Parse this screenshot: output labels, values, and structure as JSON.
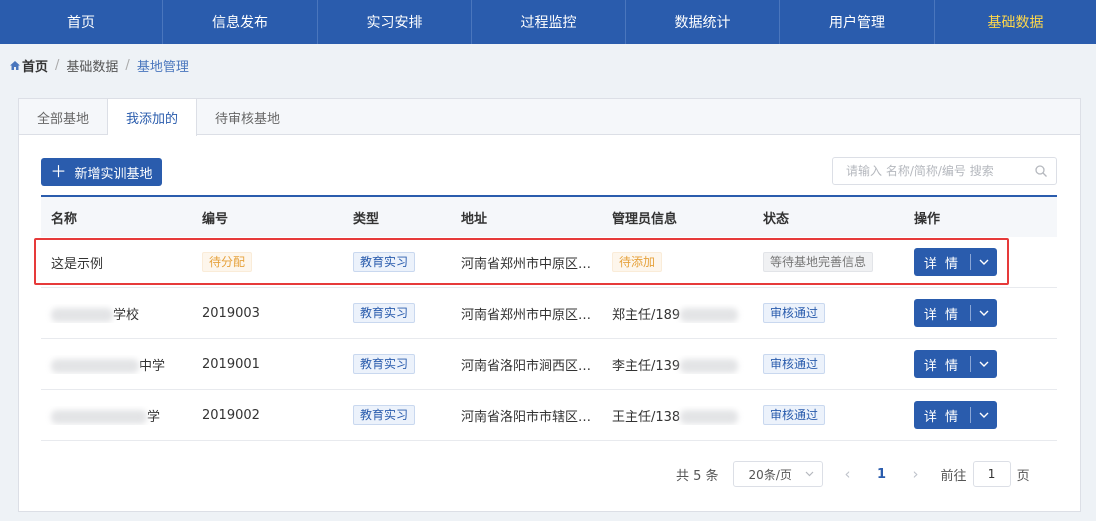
{
  "nav": [
    {
      "label": "首页",
      "name": "nav-home"
    },
    {
      "label": "信息发布",
      "name": "nav-info-publish"
    },
    {
      "label": "实习安排",
      "name": "nav-internship-arrangement"
    },
    {
      "label": "过程监控",
      "name": "nav-process-monitoring"
    },
    {
      "label": "数据统计",
      "name": "nav-data-statistics"
    },
    {
      "label": "用户管理",
      "name": "nav-user-management"
    },
    {
      "label": "基础数据",
      "name": "nav-basic-data",
      "active": true
    }
  ],
  "breadcrumb": {
    "home": "首页",
    "level1": "基础数据",
    "current": "基地管理"
  },
  "tabs": [
    "全部基地",
    "我添加的",
    "待审核基地"
  ],
  "active_tab": 1,
  "toolbar": {
    "add_label": "新增实训基地",
    "search_placeholder": "请输入 名称/简称/编号 搜索"
  },
  "table": {
    "headers": [
      "名称",
      "编号",
      "类型",
      "地址",
      "管理员信息",
      "状态",
      "操作"
    ],
    "rows": [
      {
        "name": "这是示例",
        "code": "待分配",
        "type": "教育实习",
        "address": "河南省郑州市中原区…",
        "admin": "待添加",
        "status": "等待基地完善信息",
        "action": "详 情"
      },
      {
        "name": "学校",
        "code": "2019003",
        "type": "教育实习",
        "address": "河南省郑州市中原区…",
        "admin": "郑主任/189",
        "status": "审核通过",
        "action": "详 情"
      },
      {
        "name": "中学",
        "code": "2019001",
        "type": "教育实习",
        "address": "河南省洛阳市涧西区…",
        "admin": "李主任/139",
        "status": "审核通过",
        "action": "详 情"
      },
      {
        "name": "学",
        "code": "2019002",
        "type": "教育实习",
        "address": "河南省洛阳市市辖区…",
        "admin": "王主任/138",
        "status": "审核通过",
        "action": "详 情"
      }
    ]
  },
  "pagination": {
    "total": "共 5 条",
    "page_size": "20条/页",
    "current_page": "1",
    "goto_label": "前往",
    "goto_value": "1",
    "page_suffix": "页"
  },
  "colors": {
    "primary": "#2a5cad",
    "active_nav": "#ffd84a",
    "highlight": "#e63a3a",
    "warning": "#e6a23c"
  }
}
